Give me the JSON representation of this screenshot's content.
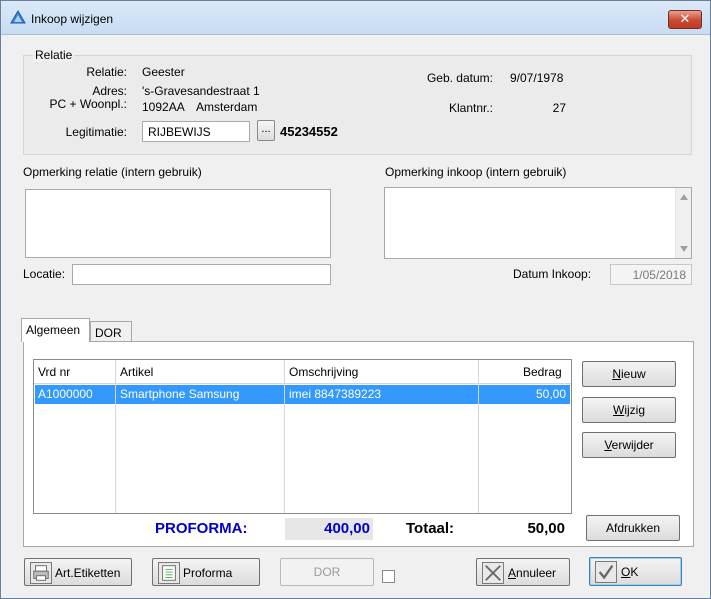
{
  "window": {
    "title": "Inkoop wijzigen"
  },
  "relatie": {
    "legend": "Relatie",
    "relatie_label": "Relatie:",
    "relatie_value": "Geester",
    "adres_label": "Adres:",
    "adres_value": "'s-Gravesandestraat 1",
    "pc_label": "PC + Woonpl.:",
    "pc_value": "1092AA",
    "woonplaats_value": "Amsterdam",
    "legitimatie_label": "Legitimatie:",
    "legitimatie_value": "RIJBEWIJS",
    "browse_label": "...",
    "legitimatie_number": "45234552",
    "geb_label": "Geb. datum:",
    "geb_value": "9/07/1978",
    "klantnr_label": "Klantnr.:",
    "klantnr_value": "27"
  },
  "opmerking_relatie": {
    "label": "Opmerking relatie (intern gebruik)",
    "value": ""
  },
  "opmerking_inkoop": {
    "label": "Opmerking inkoop (intern gebruik)",
    "value": ""
  },
  "locatie": {
    "label": "Locatie:",
    "value": ""
  },
  "datum_inkoop": {
    "label": "Datum Inkoop:",
    "value": "1/05/2018"
  },
  "tabs": [
    {
      "label": "Algemeen"
    },
    {
      "label": "DOR"
    }
  ],
  "grid": {
    "columns": [
      "Vrd nr",
      "Artikel",
      "Omschrijving",
      "Bedrag"
    ],
    "rows": [
      {
        "vrd_nr": "A1000000",
        "artikel": "Smartphone Samsung",
        "omschrijving": "imei 8847389223",
        "bedrag": "50,00"
      }
    ]
  },
  "side_buttons": {
    "nieuw": {
      "first": "N",
      "rest": "ieuw"
    },
    "wijzig": {
      "first": "W",
      "rest": "ijzig"
    },
    "verwijder": {
      "first": "V",
      "rest": "erwijder"
    },
    "afdrukken": "Afdrukken"
  },
  "totals": {
    "proforma_label": "PROFORMA:",
    "proforma_value": "400,00",
    "totaal_label": "Totaal:",
    "totaal_value": "50,00"
  },
  "bottom_buttons": {
    "art_etiketten": "Art.Etiketten",
    "proforma": "Proforma",
    "dor": "DOR",
    "annuleer": {
      "first": "A",
      "rest": "nnuleer"
    },
    "ok": {
      "first": "O",
      "rest": "K"
    }
  },
  "colors": {
    "accent": "#3399ff",
    "proforma_text": "#0000cc",
    "close_red": "#c74a34"
  }
}
